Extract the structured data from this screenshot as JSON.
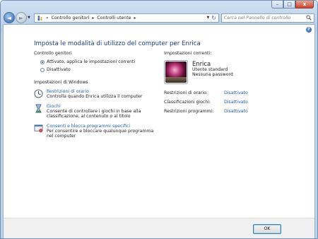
{
  "window": {
    "caption_buttons": {
      "minimize": "–",
      "maximize": "□",
      "close": "x"
    }
  },
  "navbar": {
    "back_glyph": "◄",
    "forward_glyph": "►",
    "breadcrumb": [
      {
        "label": "Controllo genitori"
      },
      {
        "label": "Controlli utente"
      }
    ],
    "breadcrumb_prefix": "«",
    "breadcrumb_separator": "▸",
    "address_dropdown": "▼",
    "refresh_glyph": "↻",
    "search_placeholder": "Cerca nel Pannello di controllo"
  },
  "main": {
    "help_glyph": "?",
    "title": "Imposta le modalità di utilizzo del computer per Enrica",
    "parental_controls": {
      "heading": "Controllo genitori",
      "options": [
        {
          "label": "Attivato, applica le impostazioni correnti",
          "selected": true
        },
        {
          "label": "Disattivato",
          "selected": false
        }
      ]
    },
    "windows_settings": {
      "heading": "Impostazioni di Windows",
      "items": [
        {
          "icon": "clock-icon",
          "link": "Restrizioni di orario",
          "desc": "Controlla quando Enrica utilizza il computer"
        },
        {
          "icon": "games-icon",
          "link": "Giochi",
          "desc": "Consente di controllare i giochi in base alla classificazione, al contenuto o al titolo"
        },
        {
          "icon": "program-icon",
          "link": "Consenti e blocca programmi specifici",
          "desc": "Per consentire e bloccare qualunque programma nel computer"
        }
      ]
    },
    "current_settings": {
      "heading": "Impostazioni correnti:",
      "user": {
        "name": "Enrica",
        "type": "Utente standard",
        "password": "Nessuna password"
      },
      "restrictions": [
        {
          "label": "Restrizioni di orario:",
          "value": "Disattivato"
        },
        {
          "label": "Classificazioni giochi:",
          "value": "Disattivato"
        },
        {
          "label": "Restrizioni programmi:",
          "value": "Disattivato"
        }
      ]
    }
  },
  "footer": {
    "ok_label": "OK"
  },
  "colors": {
    "link": "#1e5fb8",
    "title": "#1a3e8a",
    "frame": "#bcd3ea"
  }
}
